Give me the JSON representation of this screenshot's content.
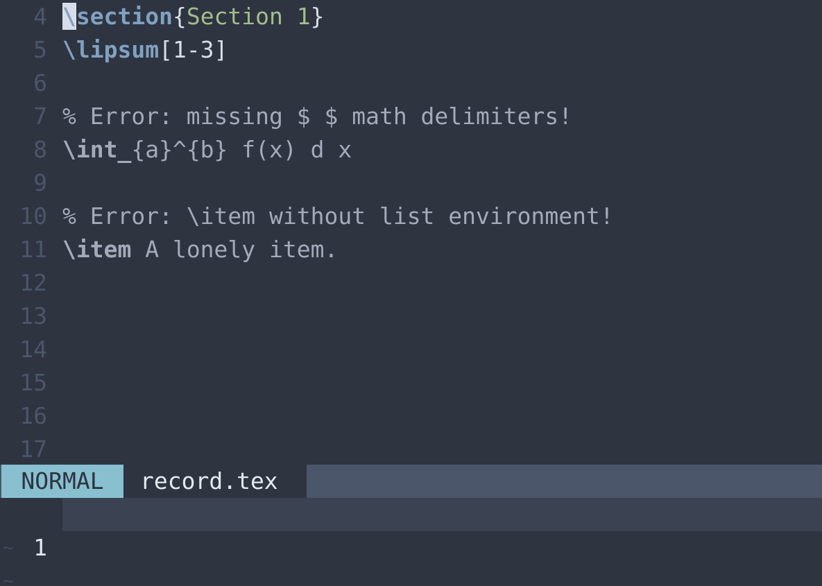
{
  "editor": {
    "lines": [
      {
        "num": "4",
        "parts": [
          {
            "cls": "cursor kw",
            "text": "\\"
          },
          {
            "cls": "kw",
            "text": "section"
          },
          {
            "cls": "brace",
            "text": "{"
          },
          {
            "cls": "str",
            "text": "Section 1"
          },
          {
            "cls": "brace",
            "text": "}"
          }
        ]
      },
      {
        "num": "5",
        "parts": [
          {
            "cls": "kw",
            "text": "\\lipsum"
          },
          {
            "cls": "brace",
            "text": "[1-3]"
          }
        ]
      },
      {
        "num": "6",
        "parts": []
      },
      {
        "num": "7",
        "parts": [
          {
            "cls": "comment",
            "text": "% Error: missing $ $ math delimiters!"
          }
        ]
      },
      {
        "num": "8",
        "parts": [
          {
            "cls": "err",
            "text": "\\int_"
          },
          {
            "cls": "dim",
            "text": "{a}^{b} f(x) d x"
          }
        ]
      },
      {
        "num": "9",
        "parts": []
      },
      {
        "num": "10",
        "parts": [
          {
            "cls": "comment",
            "text": "% Error: \\item without list environment!"
          }
        ]
      },
      {
        "num": "11",
        "parts": [
          {
            "cls": "err",
            "text": "\\item"
          },
          {
            "cls": "dim",
            "text": " A lonely item."
          }
        ]
      },
      {
        "num": "12",
        "parts": []
      },
      {
        "num": "13",
        "parts": []
      },
      {
        "num": "14",
        "parts": []
      },
      {
        "num": "15",
        "parts": []
      },
      {
        "num": "16",
        "parts": []
      },
      {
        "num": "17",
        "parts": []
      }
    ]
  },
  "statusline": {
    "mode": "NORMAL",
    "filename": "record.tex"
  },
  "bottom_pane": {
    "line_number": "1",
    "tildes": [
      "~",
      "~"
    ]
  },
  "colors": {
    "background": "#2e3440",
    "mode_bg": "#88c0d0",
    "statusline_bg": "#4c566a",
    "keyword": "#81a1c1",
    "string": "#a3be8c"
  }
}
